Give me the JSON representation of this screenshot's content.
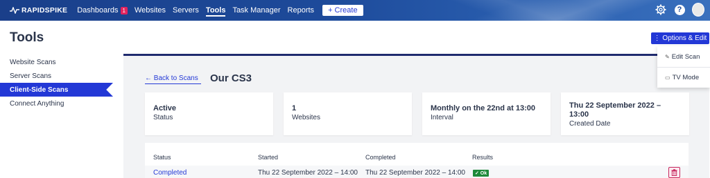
{
  "app": {
    "brand": "RAPIDSPIKE"
  },
  "nav": {
    "items": [
      {
        "label": "Dashboards",
        "badge": "1"
      },
      {
        "label": "Websites"
      },
      {
        "label": "Servers"
      },
      {
        "label": "Tools",
        "active": true
      },
      {
        "label": "Task Manager"
      },
      {
        "label": "Reports"
      }
    ],
    "create_label": "+ Create",
    "icons": [
      "gear-icon",
      "help-icon",
      "avatar"
    ]
  },
  "page": {
    "title": "Tools",
    "options_label": "⋮ Options & Edit"
  },
  "sidebar": {
    "items": [
      {
        "label": "Website Scans"
      },
      {
        "label": "Server Scans"
      },
      {
        "label": "Client-Side Scans",
        "active": true
      },
      {
        "label": "Connect Anything"
      }
    ]
  },
  "scan": {
    "back_label": "← Back to Scans",
    "name": "Our CS3",
    "cards": [
      {
        "value": "Active",
        "label": "Status"
      },
      {
        "value": "1",
        "label": "Websites"
      },
      {
        "value": "Monthly on the 22nd at 13:00",
        "label": "Interval"
      },
      {
        "value": "Thu 22 September 2022 – 13:00",
        "label": "Created Date"
      }
    ]
  },
  "table": {
    "headers": [
      "Status",
      "Started",
      "Completed",
      "Results"
    ],
    "rows": [
      {
        "status": "Completed",
        "started": "Thu 22 September 2022 – 14:00",
        "completed": "Thu 22 September 2022 – 14:00",
        "result": "✓ Ok"
      }
    ]
  },
  "dropdown": {
    "items": [
      {
        "label": "Edit Scan",
        "icon": "pencil-icon"
      },
      {
        "label": "TV Mode",
        "icon": "tv-icon"
      }
    ]
  },
  "colors": {
    "accent": "#2338d6",
    "nav_bg": "#1d4a9a",
    "ok_green": "#1e8a3a",
    "danger": "#c8285e"
  }
}
